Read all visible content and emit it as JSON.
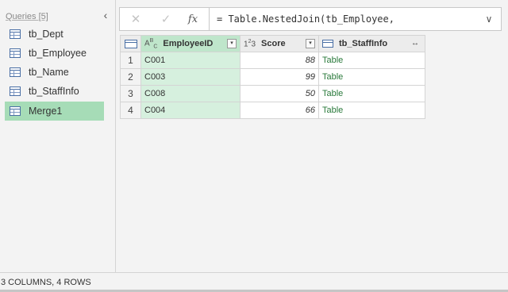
{
  "queries": {
    "title": "Queries [5]",
    "items": [
      {
        "label": "tb_Dept",
        "selected": false
      },
      {
        "label": "tb_Employee",
        "selected": false
      },
      {
        "label": "tb_Name",
        "selected": false
      },
      {
        "label": "tb_StaffInfo",
        "selected": false
      },
      {
        "label": "Merge1",
        "selected": true
      }
    ]
  },
  "formula_bar": {
    "cancel_icon": "close-icon",
    "confirm_icon": "check-icon",
    "fx_label": "fx",
    "formula": "= Table.NestedJoin(tb_Employee,"
  },
  "grid": {
    "columns": [
      {
        "name": "EmployeeID",
        "type_icon": "ABC"
      },
      {
        "name": "Score",
        "type_icon": "123"
      },
      {
        "name": "tb_StaffInfo",
        "type_icon": "table"
      }
    ],
    "rows": [
      {
        "num": "1",
        "EmployeeID": "C001",
        "Score": "88",
        "tb_StaffInfo": "Table"
      },
      {
        "num": "2",
        "EmployeeID": "C003",
        "Score": "99",
        "tb_StaffInfo": "Table"
      },
      {
        "num": "3",
        "EmployeeID": "C008",
        "Score": "50",
        "tb_StaffInfo": "Table"
      },
      {
        "num": "4",
        "EmployeeID": "C004",
        "Score": "66",
        "tb_StaffInfo": "Table"
      }
    ]
  },
  "status": {
    "text": "3 COLUMNS, 4 ROWS"
  },
  "colors": {
    "selected_query_bg": "#a6dcb7",
    "selected_column_bg": "#d6f0de",
    "table_link": "#2a7a3b"
  }
}
